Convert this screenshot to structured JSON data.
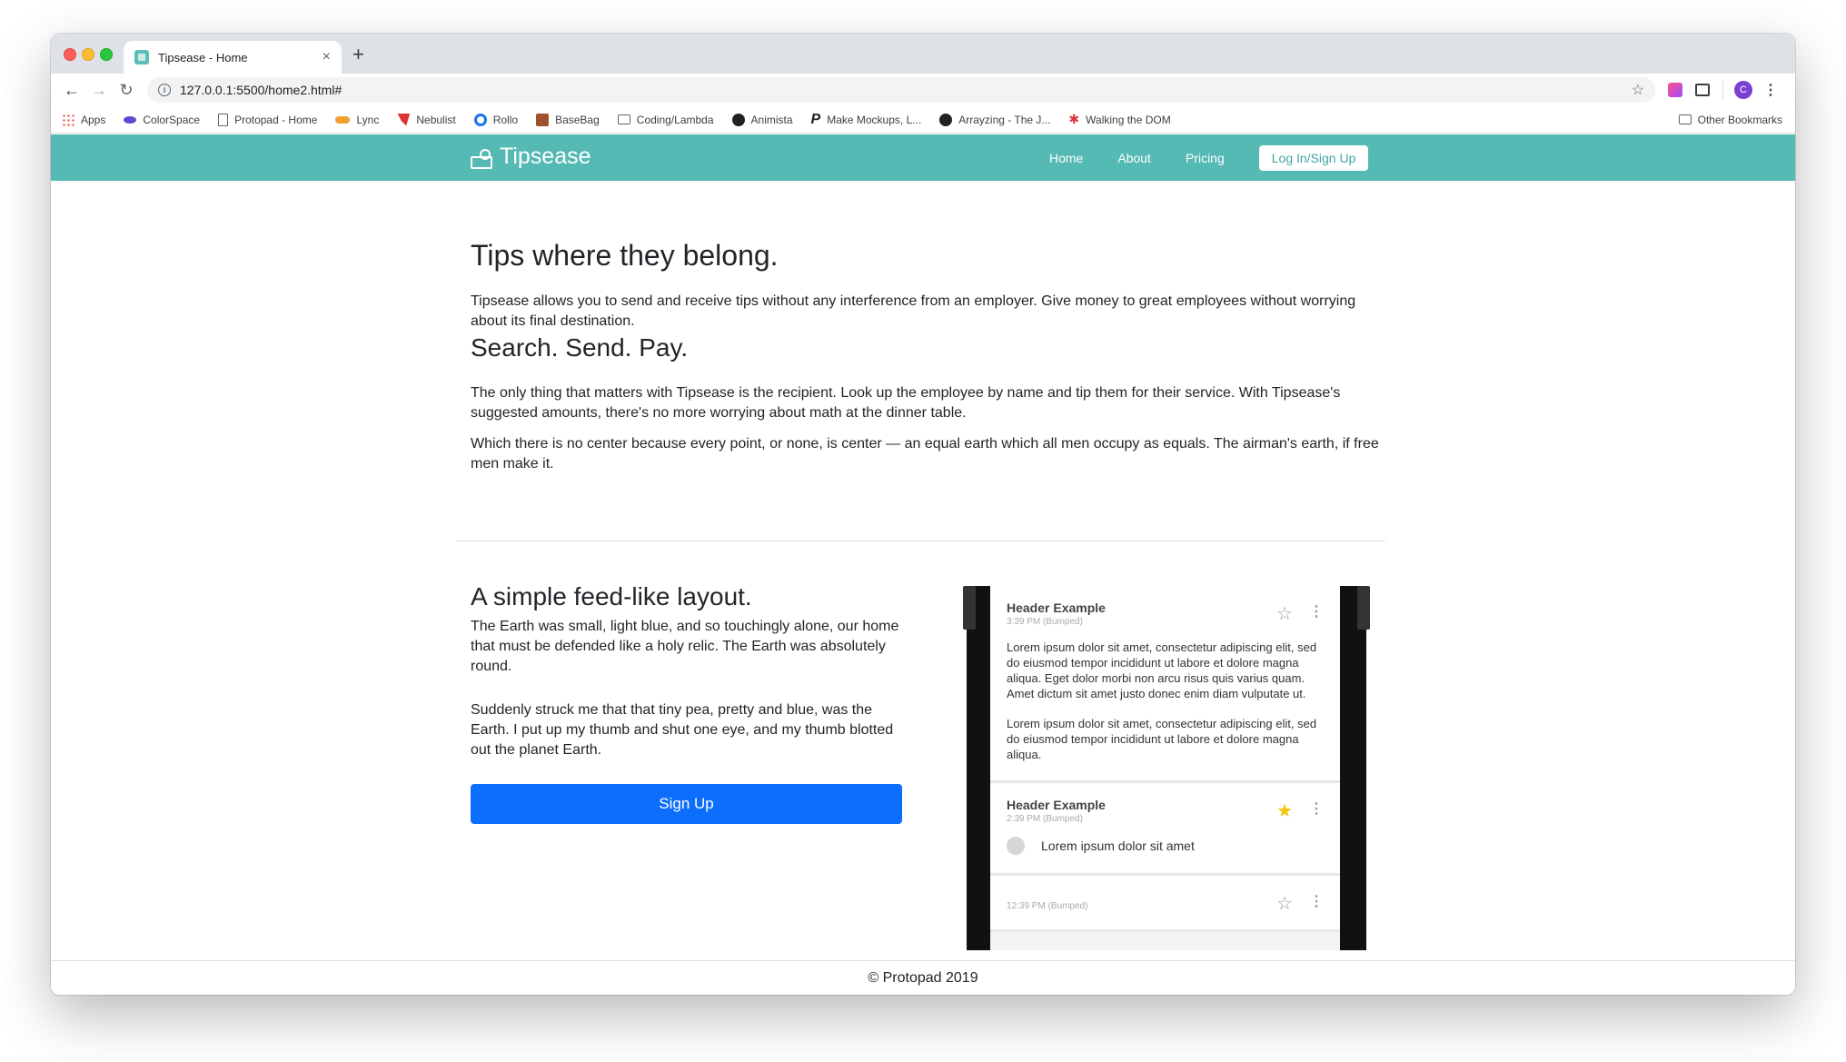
{
  "browser": {
    "tab_title": "Tipsease - Home",
    "tab_close": "×",
    "new_tab": "+",
    "url": "127.0.0.1:5500/home2.html#",
    "avatar_letter": "C",
    "bookmarks": [
      {
        "label": "Apps",
        "icon": "apps-grid-icon"
      },
      {
        "label": "ColorSpace",
        "icon": "colorspace-icon"
      },
      {
        "label": "Protopad - Home",
        "icon": "document-icon"
      },
      {
        "label": "Lync",
        "icon": "lync-icon"
      },
      {
        "label": "Nebulist",
        "icon": "nebulist-icon"
      },
      {
        "label": "Rollo",
        "icon": "rollo-icon"
      },
      {
        "label": "BaseBag",
        "icon": "basebag-icon"
      },
      {
        "label": "Coding/Lambda",
        "icon": "folder-icon"
      },
      {
        "label": "Animista",
        "icon": "animista-icon"
      },
      {
        "label": "Make Mockups, L...",
        "icon": "p-icon"
      },
      {
        "label": "Arrayzing - The J...",
        "icon": "github-icon"
      },
      {
        "label": "Walking the DOM",
        "icon": "walking-icon"
      }
    ],
    "other_bookmarks": "Other Bookmarks"
  },
  "navbar": {
    "brand": "Tipsease",
    "links": [
      "Home",
      "About",
      "Pricing"
    ],
    "login": "Log In/Sign Up",
    "color": "#55b9b4"
  },
  "hero": {
    "title": "Tips where they belong.",
    "p1": "Tipsease allows you to send and receive tips without any interference from an employer. Give money to great employees without worrying about its final destination.",
    "subtitle": "Search. Send. Pay.",
    "p2": "The only thing that matters with Tipsease is the recipient. Look up the employee by name and tip them for their service. With Tipsease's suggested amounts, there's no more worrying about math at the dinner table.",
    "p3": "Which there is no center because every point, or none, is center — an equal earth which all men occupy as equals. The airman's earth, if free men make it."
  },
  "feed": {
    "title": "A simple feed-like layout.",
    "p1": "The Earth was small, light blue, and so touchingly alone, our home that must be defended like a holy relic. The Earth was absolutely round.",
    "p2": "Suddenly struck me that that tiny pea, pretty and blue, was the Earth. I put up my thumb and shut one eye, and my thumb blotted out the planet Earth.",
    "button": "Sign Up",
    "button_color": "#0d6efd"
  },
  "phone": {
    "cards": [
      {
        "header": "Header Example",
        "time": "3:39 PM (Bumped)",
        "body1": "Lorem ipsum dolor sit amet, consectetur adipiscing elit, sed do eiusmod tempor incididunt ut labore et dolore magna aliqua. Eget dolor morbi non arcu risus quis varius quam. Amet dictum sit amet justo donec enim diam vulputate ut.",
        "body2": "Lorem ipsum dolor sit amet, consectetur adipiscing elit, sed do eiusmod tempor incididunt ut labore et dolore magna aliqua.",
        "star": "☆"
      },
      {
        "header": "Header Example",
        "time": "2:39 PM (Bumped)",
        "row": "Lorem ipsum dolor sit amet",
        "star": "★"
      },
      {
        "time": "12:39 PM (Bumped)",
        "star": "☆"
      }
    ],
    "dots": "⋮"
  },
  "footer": {
    "text": "© Protopad 2019"
  }
}
